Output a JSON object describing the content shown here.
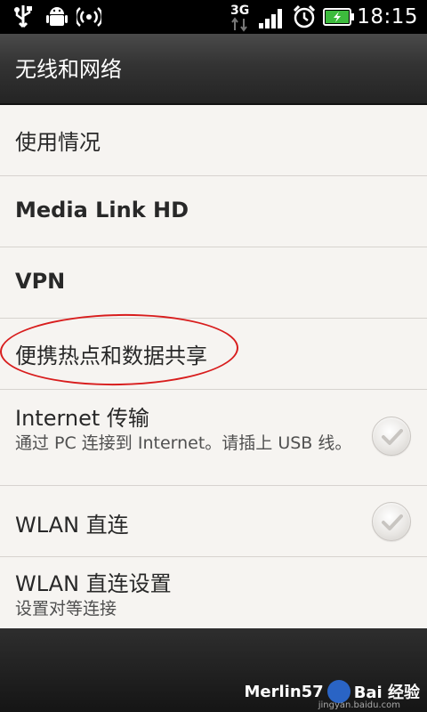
{
  "status_bar": {
    "network_type": "3G",
    "time": "18:15",
    "icons": [
      "usb-icon",
      "android-debug-icon",
      "hotspot-icon",
      "mobile-data-icon",
      "signal-icon",
      "alarm-icon",
      "battery-charging-icon"
    ]
  },
  "header": {
    "title": "无线和网络"
  },
  "settings": {
    "items": [
      {
        "title": "使用情况"
      },
      {
        "title": "Media Link HD"
      },
      {
        "title": "VPN"
      },
      {
        "title": "便携热点和数据共享"
      },
      {
        "title": "Internet 传输",
        "subtitle": "通过 PC 连接到 Internet。请插上 USB 线。",
        "checked": false
      },
      {
        "title": "WLAN 直连",
        "checked": false
      },
      {
        "title": "WLAN 直连设置",
        "subtitle": "设置对等连接"
      }
    ]
  },
  "watermark": {
    "text": "Merlin57",
    "brand": "Bai 经验",
    "url": "jingyan.baidu.com"
  },
  "colors": {
    "annotation_circle": "#d81d1d",
    "list_bg": "#f6f4f1"
  }
}
